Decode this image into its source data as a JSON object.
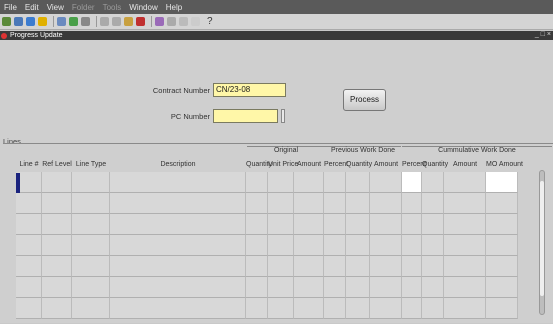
{
  "menu": [
    {
      "label": "File",
      "enabled": true
    },
    {
      "label": "Edit",
      "enabled": true
    },
    {
      "label": "View",
      "enabled": true
    },
    {
      "label": "Folder",
      "enabled": false
    },
    {
      "label": "Tools",
      "enabled": false
    },
    {
      "label": "Window",
      "enabled": true
    },
    {
      "label": "Help",
      "enabled": true
    }
  ],
  "toolbar": {
    "help_glyph": "?"
  },
  "window": {
    "title": "Progress Update",
    "controls": "_ □ ×"
  },
  "form": {
    "contract_label": "Contract Number",
    "contract_value": "CN/23-08",
    "pc_label": "PC Number",
    "pc_value": "",
    "process_label": "Process"
  },
  "lines": {
    "group_title": "Lines",
    "columns": {
      "line": "Line #",
      "ref_level": "Ref Level",
      "line_type": "Line Type",
      "description": "Description",
      "quantity": "Quantity",
      "unit_price": "Unit Price",
      "amount": "Amount",
      "percent": "Percent",
      "prev_quantity": "Quantity",
      "prev_amount": "Amount",
      "cum_percent": "Percent",
      "cum_quantity": "Quantity",
      "cum_amount": "Amount",
      "mo_amount": "MO Amount"
    },
    "span_headers": {
      "original": "Original",
      "previous": "Previous Work Done",
      "cumulative": "Cummulative Work Done"
    }
  },
  "colors": {
    "required_field": "#fff7a8",
    "cursor": "#1a237e"
  }
}
